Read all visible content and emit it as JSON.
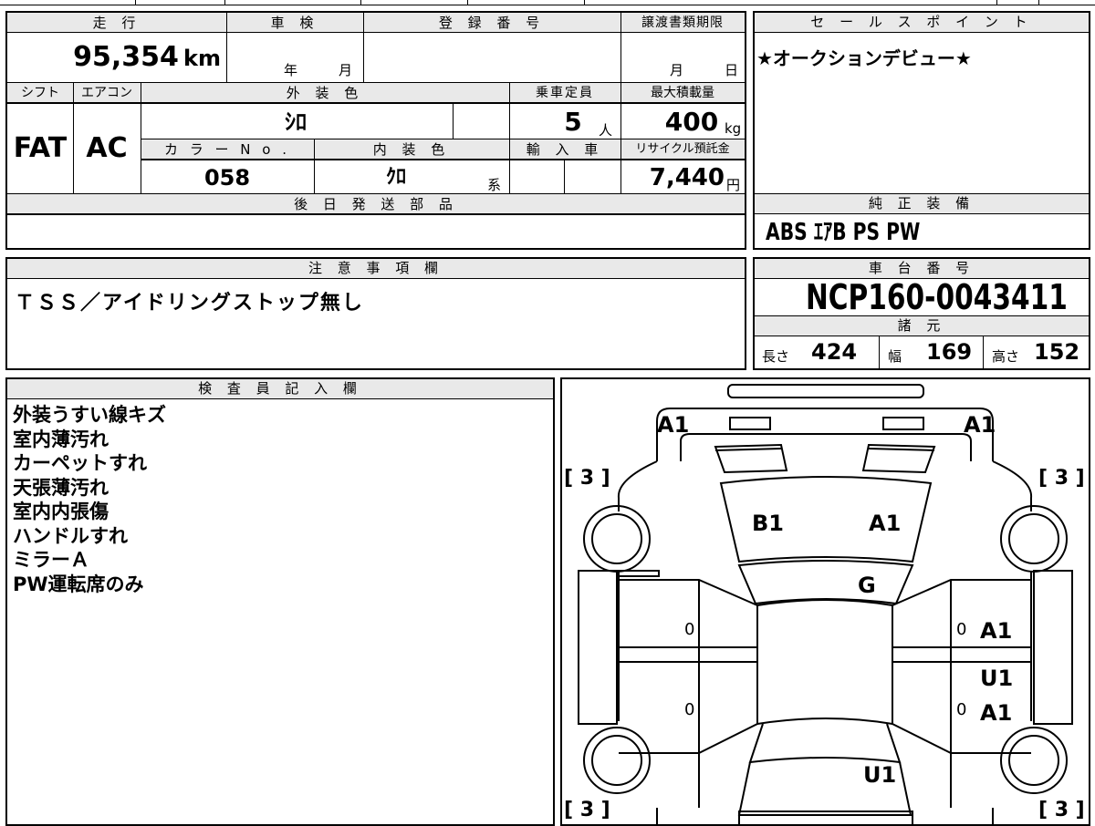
{
  "spec": {
    "mileage_label": "走 行",
    "inspection_label": "車 検",
    "registration_label": "登 録 番 号",
    "transfer_label": "譲渡書類期限",
    "mileage_value": "95,354",
    "mileage_unit": "km",
    "inspection_year_unit": "年",
    "inspection_month_unit": "月",
    "transfer_month_unit": "月",
    "transfer_day_unit": "日",
    "shift_label": "シフト",
    "ac_label": "エアコン",
    "exterior_color_label": "外 装 色",
    "capacity_label": "乗車定員",
    "max_load_label": "最大積載量",
    "shift_value": "FAT",
    "ac_value": "AC",
    "exterior_color_value": "ｼﾛ",
    "capacity_value": "5",
    "capacity_unit": "人",
    "max_load_value": "400",
    "max_load_unit": "kg",
    "color_no_label": "カ ラ ー N o .",
    "interior_color_label": "内 装 色",
    "import_label": "輸 入 車",
    "recycle_label": "リサイクル預託金",
    "color_no_value": "058",
    "interior_color_value": "ｸﾛ",
    "interior_color_suffix": "系",
    "recycle_value": "7,440",
    "recycle_unit": "円",
    "later_parts_label": "後 日 発 送 部 品"
  },
  "sales_point": {
    "label": "セ ー ル ス ポ イ ン ト",
    "text": "★オークションデビュー★"
  },
  "equipment": {
    "label": "純 正 装 備",
    "text": "ABS ｴｱB PS PW"
  },
  "notes": {
    "label": "注 意 事 項 欄",
    "text": "ＴＳＳ／アイドリングストップ無し"
  },
  "chassis": {
    "label": "車 台 番 号",
    "number": "NCP160-0043411",
    "dimensions_label": "諸 元",
    "length_label": "長さ",
    "length_value": "424",
    "width_label": "幅",
    "width_value": "169",
    "height_label": "高さ",
    "height_value": "152"
  },
  "inspector": {
    "label": "検 査 員 記 入 欄",
    "lines": [
      "外装うすい線キズ",
      "室内薄汚れ",
      "カーペットすれ",
      "天張薄汚れ",
      "室内内張傷",
      "ハンドルすれ",
      "ミラーＡ",
      "PW運転席のみ"
    ]
  },
  "diagram": {
    "marks": {
      "front_left": "A1",
      "front_right": "A1",
      "hood_left": "B1",
      "hood_right": "A1",
      "windshield": "G",
      "right_front_door": "A1",
      "right_middle": "U1",
      "right_rear_door": "A1",
      "rear": "U1",
      "door_left_front_zero": "0",
      "door_left_rear_zero": "0",
      "door_right_front_zero": "0",
      "door_right_rear_zero": "0"
    },
    "tire_tl": "[ 3 ]",
    "tire_tr": "[ 3 ]",
    "tire_bl": "[ 3 ]",
    "tire_br": "[ 3 ]"
  }
}
